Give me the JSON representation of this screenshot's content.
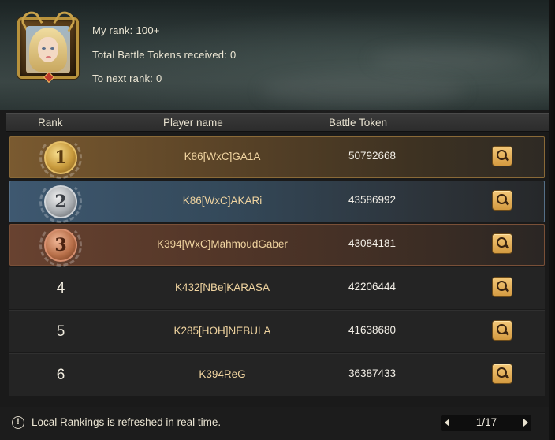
{
  "player": {
    "my_rank_label": "My rank:",
    "my_rank_value": "100+",
    "tokens_label": "Total Battle Tokens received:",
    "tokens_value": "0",
    "next_rank_label": "To next rank:",
    "next_rank_value": "0"
  },
  "table": {
    "headers": {
      "rank": "Rank",
      "player_name": "Player name",
      "battle_token": "Battle Token"
    },
    "rows": [
      {
        "rank": "1",
        "name": "K86[WxC]GA1A",
        "tokens": "50792668",
        "style": "gold"
      },
      {
        "rank": "2",
        "name": "K86[WxC]AKARi",
        "tokens": "43586992",
        "style": "silver"
      },
      {
        "rank": "3",
        "name": "K394[WxC]MahmoudGaber",
        "tokens": "43084181",
        "style": "bronze"
      },
      {
        "rank": "4",
        "name": "K432[NBe]KARASA",
        "tokens": "42206444",
        "style": "plain"
      },
      {
        "rank": "5",
        "name": "K285[HOH]NEBULA",
        "tokens": "41638680",
        "style": "plain"
      },
      {
        "rank": "6",
        "name": "K394ReG",
        "tokens": "36387433",
        "style": "plain"
      }
    ]
  },
  "footer": {
    "notice": "Local Rankings is refreshed in real time.",
    "page": "1/17"
  },
  "colors": {
    "name_text": "#f0d4a0",
    "search_button": "#e8b25a",
    "gold_row": "#7a5a30",
    "silver_row": "#3e5870",
    "bronze_row": "#684230"
  }
}
